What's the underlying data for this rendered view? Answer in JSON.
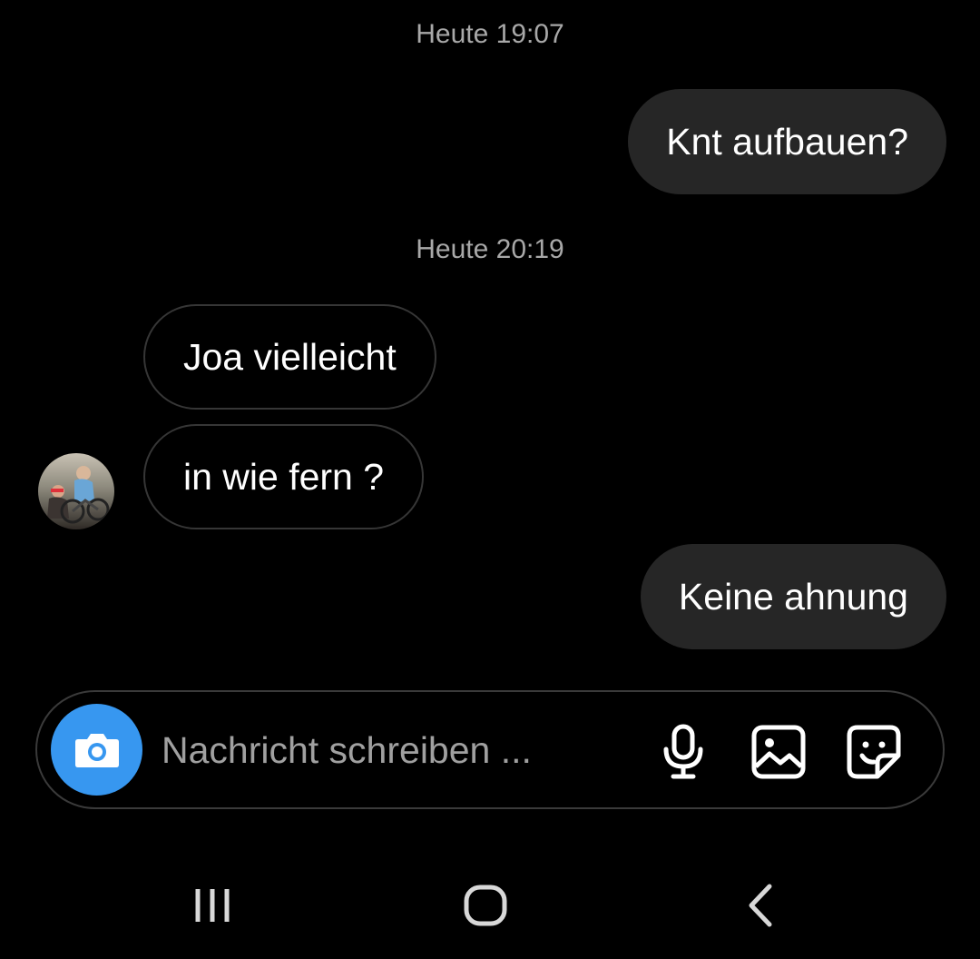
{
  "conversation": {
    "groups": [
      {
        "timestamp": "Heute 19:07",
        "messages": [
          {
            "direction": "outgoing",
            "text": "Knt aufbauen?"
          }
        ]
      },
      {
        "timestamp": "Heute 20:19",
        "messages": [
          {
            "direction": "incoming",
            "text": "Joa vielleicht"
          },
          {
            "direction": "incoming",
            "text": "in wie fern ?"
          },
          {
            "direction": "outgoing",
            "text": "Keine ahnung"
          }
        ]
      }
    ]
  },
  "composer": {
    "placeholder": "Nachricht schreiben ...",
    "camera_icon": "camera-icon",
    "tools": [
      "microphone-icon",
      "gallery-icon",
      "sticker-icon"
    ],
    "accent_color": "#3797f0"
  },
  "navbar": {
    "buttons": [
      "recent-apps-icon",
      "home-icon",
      "back-icon"
    ]
  },
  "colors": {
    "background": "#000000",
    "outgoing_bubble": "#262626",
    "incoming_bubble_border": "#363636",
    "timestamp": "#a8a8a8"
  }
}
